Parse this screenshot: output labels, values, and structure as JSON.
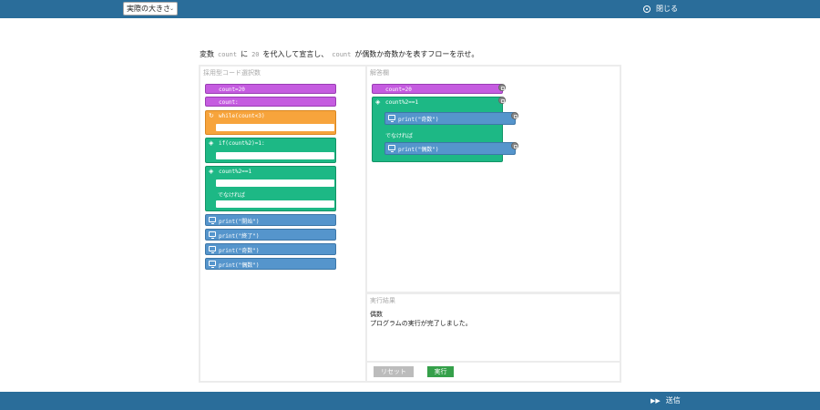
{
  "topbar": {
    "zoom_value": "実際の大きさ",
    "close_label": "閉じる"
  },
  "bottombar": {
    "submit_label": "送信"
  },
  "question": {
    "part1": "変数",
    "var1": "count",
    "part2": "に",
    "num": "20",
    "part3": "を代入して宣言し、",
    "var2": "count",
    "part4": "が偶数か奇数かを表すフローを示せ。"
  },
  "choice_panel": {
    "title": "採用型コード選択数",
    "blocks": {
      "assign": "count=20",
      "count": "count:",
      "while": "while(count<3)",
      "if": "if(count%2)=1:",
      "ifelse": "count%2==1",
      "ifelse_else": "でなければ",
      "print_start": "print(\"開始\")",
      "print_end": "print(\"終了\")",
      "print_odd": "print(\"奇数\")",
      "print_even": "print(\"偶数\")"
    }
  },
  "answer_panel": {
    "title": "解答欄",
    "blocks": {
      "assign": "count=20",
      "ifelse": "count%2==1",
      "print_odd": "print(\"奇数\")",
      "else_label": "でなければ",
      "print_even": "print(\"偶数\")"
    }
  },
  "result_panel": {
    "title": "実行結果",
    "line1": "偶数",
    "line2": "プログラムの実行が完了しました。"
  },
  "controls": {
    "reset_label": "リセット",
    "run_label": "実行"
  },
  "colors": {
    "bar": "#2a6d9a",
    "purple": "#c55ce0",
    "orange": "#f7a43c",
    "green": "#1db885",
    "blue": "#5595cc",
    "run": "#35a04a"
  }
}
